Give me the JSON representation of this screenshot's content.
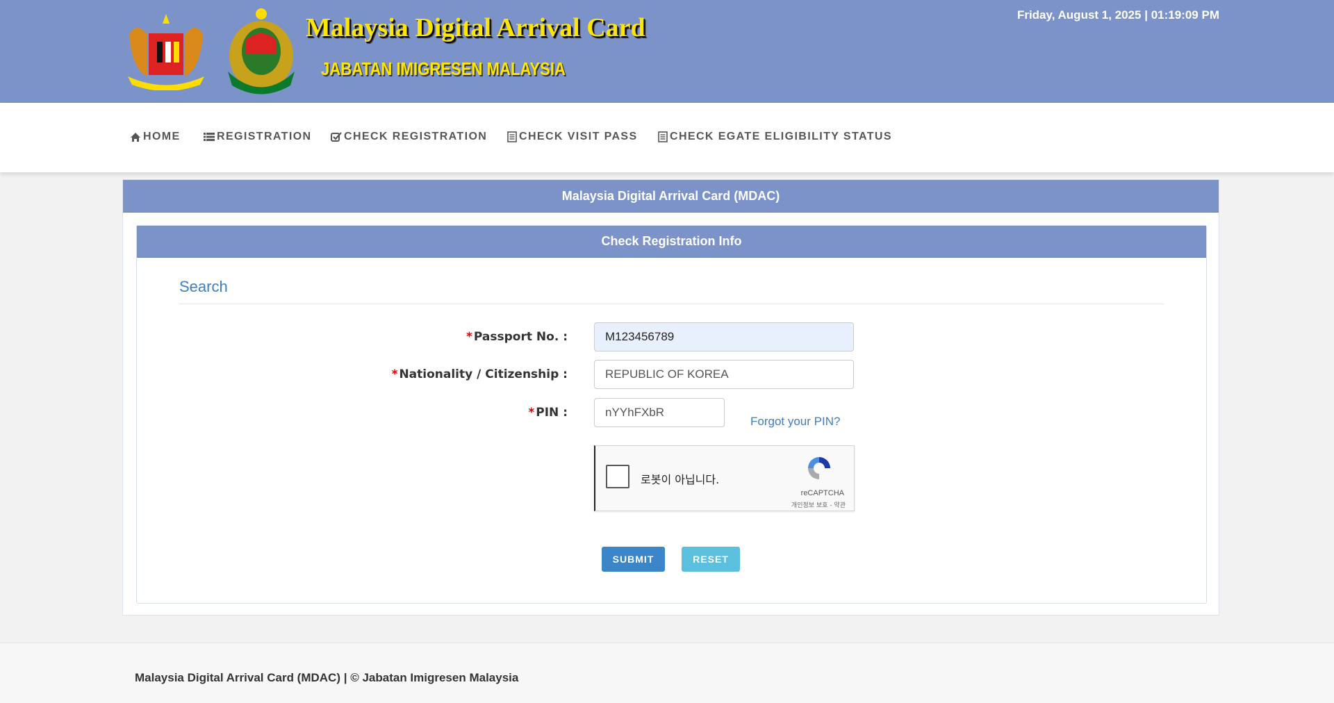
{
  "header": {
    "datetime": "Friday, August 1, 2025 | 01:19:09 PM",
    "title": "Malaysia Digital Arrival Card",
    "subtitle": "JABATAN IMIGRESEN MALAYSIA"
  },
  "nav": [
    {
      "label": "HOME",
      "icon": "home-icon"
    },
    {
      "label": "REGISTRATION",
      "icon": "list-icon"
    },
    {
      "label": "CHECK REGISTRATION",
      "icon": "check-square-icon"
    },
    {
      "label": "CHECK VISIT PASS",
      "icon": "document-icon"
    },
    {
      "label": "CHECK EGATE ELIGIBILITY STATUS",
      "icon": "document-icon"
    }
  ],
  "panel": {
    "title": "Malaysia Digital Arrival Card (MDAC)",
    "subtitle": "Check Registration Info",
    "section": "Search"
  },
  "form": {
    "required_mark": "*",
    "passport_label": "Passport No. :",
    "passport_value": "M123456789",
    "nationality_label": "Nationality / Citizenship :",
    "nationality_value": "REPUBLIC OF KOREA",
    "pin_label": "PIN :",
    "pin_value": "nYYhFXbR",
    "forgot": "Forgot your PIN?"
  },
  "captcha": {
    "label": "로봇이 아닙니다.",
    "brand": "reCAPTCHA",
    "links": "개인정보 보호 - 약관"
  },
  "buttons": {
    "submit": "SUBMIT",
    "reset": "RESET"
  },
  "colors": {
    "brand": "#7b93c9",
    "submit": "#3a86c8",
    "reset": "#5bc0de"
  },
  "footer": "Malaysia Digital Arrival Card (MDAC) | © Jabatan Imigresen Malaysia"
}
